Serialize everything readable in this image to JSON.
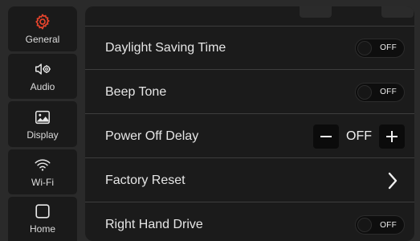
{
  "sidebar": {
    "items": [
      {
        "label": "General",
        "icon": "gear-icon",
        "active": true
      },
      {
        "label": "Audio",
        "icon": "speaker-gear-icon"
      },
      {
        "label": "Display",
        "icon": "image-icon"
      },
      {
        "label": "Wi-Fi",
        "icon": "wifi-icon"
      },
      {
        "label": "Home",
        "icon": "home-square-icon"
      }
    ]
  },
  "settings": {
    "daylight_saving": {
      "label": "Daylight Saving Time",
      "state": "OFF"
    },
    "beep_tone": {
      "label": "Beep Tone",
      "state": "OFF"
    },
    "power_off_delay": {
      "label": "Power Off Delay",
      "value": "OFF"
    },
    "factory_reset": {
      "label": "Factory Reset"
    },
    "right_hand_drive": {
      "label": "Right Hand Drive",
      "state": "OFF"
    }
  },
  "colors": {
    "accent": "#e8442c",
    "background": "#2a2a2a",
    "panel": "#1b1b1b"
  }
}
